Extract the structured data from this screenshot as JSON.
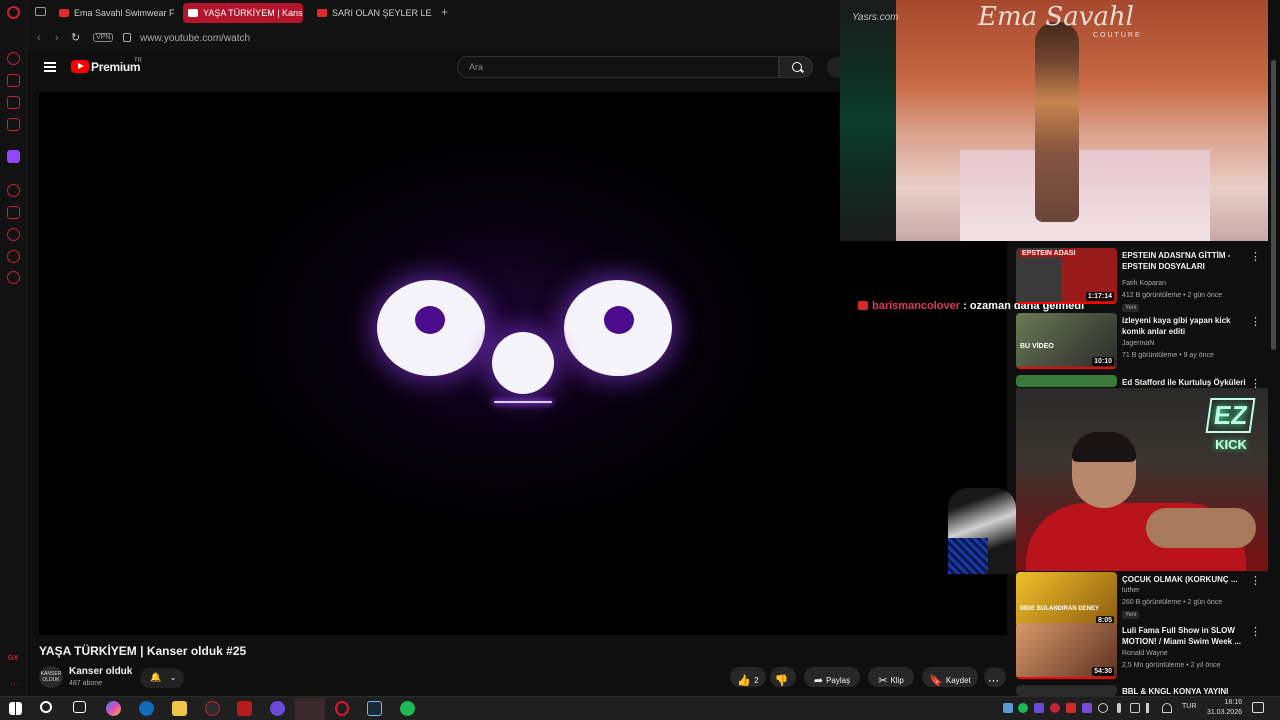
{
  "browser": {
    "tabs": [
      {
        "label": "Ema Savahl Swimwear Fas",
        "active": false
      },
      {
        "label": "YAŞA TÜRKİYEM | Kanser",
        "active": true
      },
      {
        "label": "SARI OLAN ŞEYLER LEZZE",
        "active": false
      }
    ],
    "new_tab_label": "+",
    "vpn_label": "VPN",
    "url": "www.youtube.com/watch"
  },
  "youtube": {
    "brand": "Premium",
    "brand_region": "TR",
    "search_placeholder": "Ara"
  },
  "video": {
    "title": "YAŞA TÜRKİYEM | Kanser olduk #25",
    "channel_name": "Kanser olduk",
    "channel_avatar_text": "KANSER OLDUK",
    "subscribers": "487 abone",
    "likes": "2",
    "actions": {
      "share": "Paylaş",
      "clip": "Klip",
      "save": "Kaydet"
    }
  },
  "overlay": {
    "runway_logo": "Ema Savahl",
    "runway_logo_sub": "COUTURE",
    "runway_watermark": "Yasrs.com"
  },
  "chat": {
    "user": "barismancolover",
    "message": ": ozaman daha gelmedi"
  },
  "stream_logo": {
    "top": "EZ",
    "bottom": "KICK"
  },
  "recommendations": [
    {
      "title": "EPSTEIN ADASI'NA GİTTİM - EPSTEIN DOSYALARI",
      "channel": "Fatih Koparan",
      "meta": "412 B görüntüleme • 2 gün önce",
      "badge": "Yeni",
      "duration": "1:17:14",
      "thumb_text": "EPSTEIN ADASI",
      "thumb_color": "#9a1b1b"
    },
    {
      "title": "izleyeni kaya gibi yapan kick komik anlar editi",
      "channel": "JagermaN",
      "meta": "71 B görüntüleme • 9 ay önce",
      "duration": "10:10",
      "thumb_text": "BU VİDEO",
      "thumb_color": "#4a5a3a"
    },
    {
      "title": "Ed Stafford ile Kurtuluş Öyküleri",
      "thumb_color": "#3a7a3a"
    },
    {
      "title": "ÇOCUK OLMAK (KORKUNÇ ...",
      "channel": "luther",
      "meta": "260 B görüntüleme • 2 gün önce",
      "badge": "Yeni",
      "duration": "8:05",
      "thumb_text": "MİDE BULANDIRAN DENEY",
      "thumb_color": "#e0b020"
    },
    {
      "title": "Luli Fama Full Show in SLOW MOTION! / Miami Swim Week ...",
      "channel": "Ronald Wayne",
      "meta": "2,5 Mn görüntüleme • 2 yıl önce",
      "duration": "54:30",
      "thumb_color": "#c07a4a"
    },
    {
      "title": "BBL & KNGL KONYA YAYINI",
      "thumb_color": "#222222"
    }
  ],
  "taskbar": {
    "language": "TUR",
    "time": "18:16",
    "date": "31.03.2026"
  },
  "sidebar_label": "GX"
}
